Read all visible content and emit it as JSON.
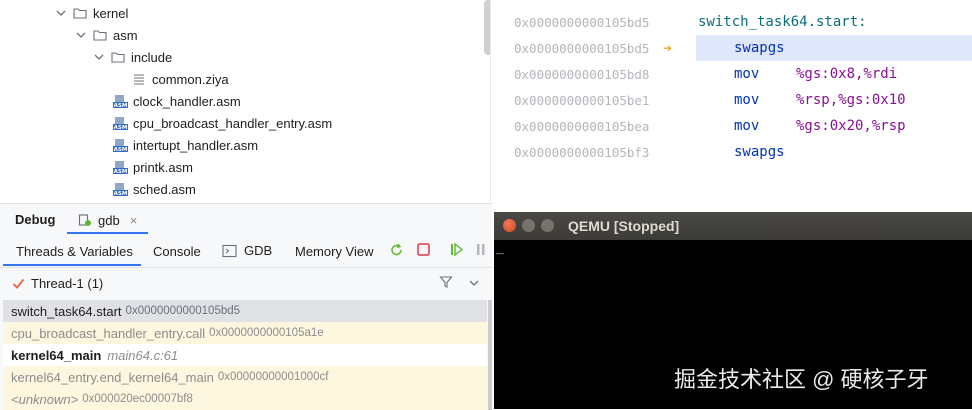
{
  "project_tree": {
    "items": [
      {
        "label": "kernel",
        "kind": "folder",
        "expanded": true
      },
      {
        "label": "asm",
        "kind": "folder",
        "expanded": true
      },
      {
        "label": "include",
        "kind": "folder",
        "expanded": true
      },
      {
        "label": "common.ziya",
        "kind": "file"
      },
      {
        "label": "clock_handler.asm",
        "kind": "asm"
      },
      {
        "label": "cpu_broadcast_handler_entry.asm",
        "kind": "asm"
      },
      {
        "label": "intertupt_handler.asm",
        "kind": "asm"
      },
      {
        "label": "printk.asm",
        "kind": "asm"
      },
      {
        "label": "sched.asm",
        "kind": "asm"
      }
    ],
    "asm_badge": "ASM"
  },
  "disassembly": {
    "rows": [
      {
        "addr": "0x0000000000105bd5",
        "label": "switch_task64.start:"
      },
      {
        "addr": "0x0000000000105bd5",
        "mnemonic": "swapgs",
        "current": true
      },
      {
        "addr": "0x0000000000105bd8",
        "mnemonic": "mov",
        "operands": "%gs:0x8,%rdi"
      },
      {
        "addr": "0x0000000000105be1",
        "mnemonic": "mov",
        "operands": "%rsp,%gs:0x10"
      },
      {
        "addr": "0x0000000000105bea",
        "mnemonic": "mov",
        "operands": "%gs:0x20,%rsp"
      },
      {
        "addr": "0x0000000000105bf3",
        "mnemonic": "swapgs"
      }
    ],
    "arrow": "➔"
  },
  "debug": {
    "title": "Debug",
    "session_tab": "gdb",
    "close": "×",
    "subtabs": {
      "threads": "Threads & Variables",
      "console": "Console",
      "gdb": "GDB",
      "memory": "Memory View"
    },
    "thread_selector": "Thread-1 (1)",
    "frames": [
      {
        "name": "switch_task64.start",
        "loc": "0x0000000000105bd5"
      },
      {
        "name": "cpu_broadcast_handler_entry.call",
        "loc": "0x0000000000105a1e"
      },
      {
        "name": "kernel64_main",
        "loc": "main64.c:61"
      },
      {
        "name": "kernel64_entry.end_kernel64_main",
        "loc": "0x00000000001000cf"
      },
      {
        "name": "<unknown>",
        "loc": "0x000020ec00007bf8"
      }
    ]
  },
  "qemu": {
    "title": "QEMU [Stopped]",
    "cursor": "_"
  },
  "watermark": "掘金技术社区 @ 硬核子牙"
}
